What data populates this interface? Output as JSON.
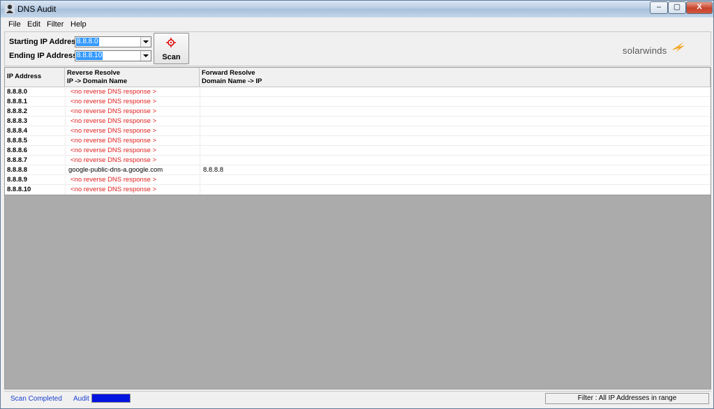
{
  "window": {
    "title": "DNS Audit",
    "app_icon": "person-network-icon",
    "controls": {
      "minimize": "–",
      "maximize": "▢",
      "close": "X"
    }
  },
  "menu": [
    "File",
    "Edit",
    "Filter",
    "Help"
  ],
  "toolbar": {
    "start_label": "Starting IP Address",
    "start_value": "8.8.8.0",
    "end_label": "Ending IP Address",
    "end_value": "8.8.8.10",
    "scan_label": "Scan",
    "scan_icon": "crosshair-target-icon",
    "logo_text": "solarwinds",
    "logo_icon": "solarwinds-flame-icon"
  },
  "grid": {
    "headers": {
      "ip": "IP Address",
      "reverse_l1": "Reverse Resolve",
      "reverse_l2": "IP -> Domain Name",
      "forward_l1": "Forward Resolve",
      "forward_l2": "Domain Name -> IP"
    },
    "rows": [
      {
        "ip": "8.8.8.0",
        "reverse": "<no reverse DNS response >",
        "forward": "",
        "no_response": true
      },
      {
        "ip": "8.8.8.1",
        "reverse": "<no reverse DNS response >",
        "forward": "",
        "no_response": true
      },
      {
        "ip": "8.8.8.2",
        "reverse": "<no reverse DNS response >",
        "forward": "",
        "no_response": true
      },
      {
        "ip": "8.8.8.3",
        "reverse": "<no reverse DNS response >",
        "forward": "",
        "no_response": true
      },
      {
        "ip": "8.8.8.4",
        "reverse": "<no reverse DNS response >",
        "forward": "",
        "no_response": true
      },
      {
        "ip": "8.8.8.5",
        "reverse": "<no reverse DNS response >",
        "forward": "",
        "no_response": true
      },
      {
        "ip": "8.8.8.6",
        "reverse": "<no reverse DNS response >",
        "forward": "",
        "no_response": true
      },
      {
        "ip": "8.8.8.7",
        "reverse": "<no reverse DNS response >",
        "forward": "",
        "no_response": true
      },
      {
        "ip": "8.8.8.8",
        "reverse": "google-public-dns-a.google.com",
        "forward": "8.8.8.8",
        "no_response": false
      },
      {
        "ip": "8.8.8.9",
        "reverse": "<no reverse DNS response >",
        "forward": "",
        "no_response": true
      },
      {
        "ip": "8.8.8.10",
        "reverse": "<no reverse DNS response >",
        "forward": "",
        "no_response": true
      }
    ]
  },
  "status": {
    "message": "Scan Completed",
    "audit_label": "Audit",
    "progress": 1.0,
    "filter_text": "Filter : All IP Addresses in range"
  },
  "colors": {
    "no_response": "#e02020",
    "status_text": "#1a3fd0",
    "progress_fill": "#0014e0",
    "selection": "#3399ff"
  }
}
